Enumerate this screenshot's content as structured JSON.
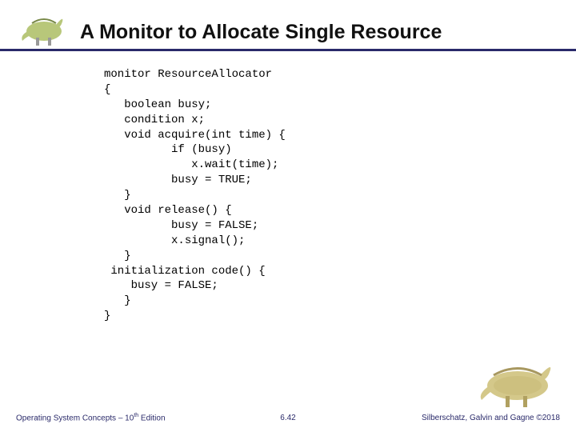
{
  "title": "A Monitor to Allocate Single Resource",
  "code": "monitor ResourceAllocator\n{\n   boolean busy;\n   condition x;\n   void acquire(int time) {\n          if (busy)\n             x.wait(time);\n          busy = TRUE;\n   }\n   void release() {\n          busy = FALSE;\n          x.signal();\n   }\n initialization code() {\n    busy = FALSE;\n   }\n}",
  "footer": {
    "left_prefix": "Operating System Concepts – 10",
    "left_sup": "th",
    "left_suffix": " Edition",
    "center": "6.42",
    "right": "Silberschatz, Galvin and Gagne ©2018"
  }
}
